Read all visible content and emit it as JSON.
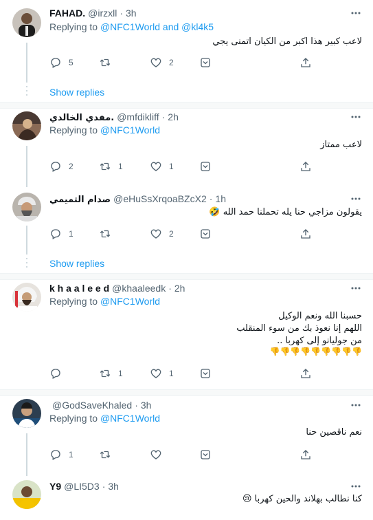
{
  "icons": {
    "reply": "reply-icon",
    "retweet": "retweet-icon",
    "like": "like-icon",
    "share": "share-icon",
    "upload": "upload-icon",
    "more": "more-icon"
  },
  "colors": {
    "link": "#1d9bf0",
    "secondary": "#536471",
    "text": "#0f1419",
    "divider": "#cfd9de"
  },
  "tweets": [
    {
      "name": "FAHAD.",
      "handle": "@irzxll",
      "dot": "·",
      "time": "3h",
      "replying_prefix": "Replying to",
      "replying_to": "@NFC1World and @kl4k5",
      "text": "لاعب كبير هذا اكبر من الكيان اتمنى يجي",
      "replies": "5",
      "retweets": "",
      "likes": "2",
      "show_replies": "Show replies"
    },
    {
      "name": "مفدي الخالدي.",
      "handle": "@mfdikliff",
      "dot": "·",
      "time": "2h",
      "replying_prefix": "Replying to",
      "replying_to": "@NFC1World",
      "text": "لاعب ممتاز",
      "replies": "2",
      "retweets": "1",
      "likes": "1"
    },
    {
      "name": "صدام التميمي",
      "handle": "@eHuSsXrqoaBZcX2",
      "dot": "·",
      "time": "1h",
      "text": "يقولون مزاجي حنا يله تحملنا حمد الله 🤣",
      "replies": "1",
      "retweets": "",
      "likes": "2",
      "show_replies": "Show replies"
    },
    {
      "name": "k h a a l e e d",
      "handle": "@khaaleedk",
      "dot": "·",
      "time": "2h",
      "replying_prefix": "Replying to",
      "replying_to": "@NFC1World",
      "text_lines": [
        "حسبنا الله ونعم الوكيل",
        "اللهم إنا نعوذ بك من سوء المنقلب",
        "من جوليانو إلى كهربا ..",
        "👎👎👎👎👎👎👎👎👎"
      ],
      "replies": "",
      "retweets": "1",
      "likes": "1"
    },
    {
      "name": "",
      "handle": "@GodSaveKhaled",
      "dot": "·",
      "time": "3h",
      "replying_prefix": "Replying to",
      "replying_to": "@NFC1World",
      "text": "نعم ناقصين حنا",
      "replies": "1",
      "retweets": "",
      "likes": ""
    },
    {
      "name": "Y9",
      "handle": "@LI5D3",
      "dot": "·",
      "time": "3h",
      "text": "كنا نطالب بهلاند والحين كهربا 😢"
    }
  ]
}
